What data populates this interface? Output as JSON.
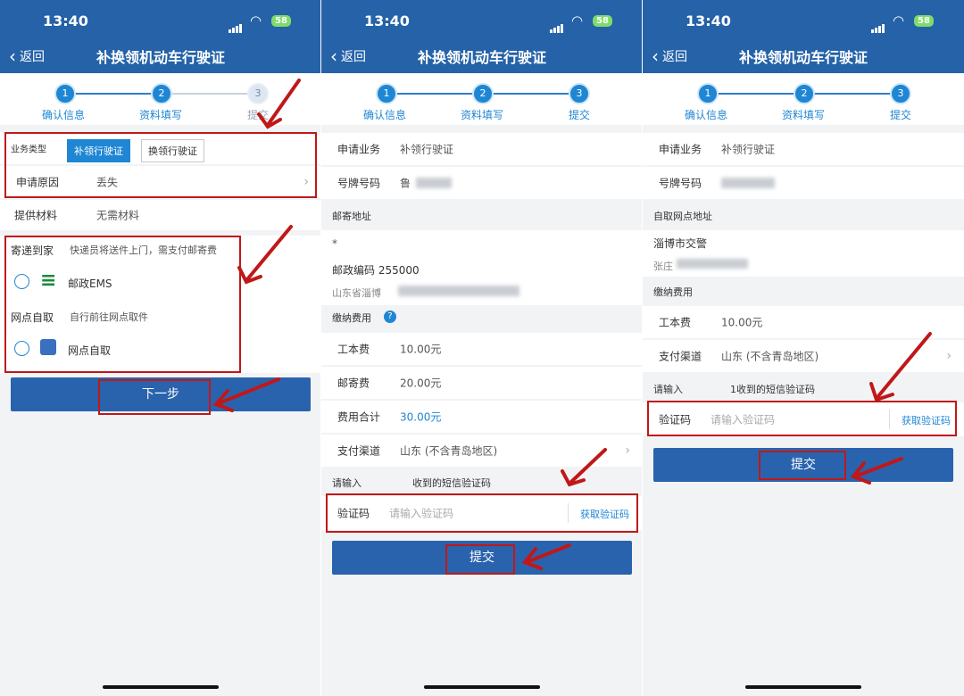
{
  "status_bar": {
    "time": "13:40",
    "battery": "58"
  },
  "nav": {
    "back_label": "返回",
    "title": "补换领机动车行驶证"
  },
  "steps": [
    "确认信息",
    "资料填写",
    "提交"
  ],
  "steps_partial_label": "提交",
  "panel1": {
    "business_type_label": "业务类型",
    "type_tabs": [
      "补领行驶证",
      "换领行驶证"
    ],
    "reason_label": "申请原因",
    "reason_value": "丢失",
    "materials_label": "提供材料",
    "materials_value": "无需材料",
    "delivery_label": "寄递到家",
    "delivery_desc": "快递员将送件上门，需支付邮寄费",
    "ems_label": "邮政EMS",
    "pickup_label": "网点自取",
    "pickup_desc": "自行前往网点取件",
    "pickup_option": "网点自取",
    "next_button": "下一步"
  },
  "panel2": {
    "apply_label": "申请业务",
    "apply_value": "补领行驶证",
    "plate_label": "号牌号码",
    "plate_value": "鲁",
    "mail_section": "邮寄地址",
    "asterisk": "*",
    "postcode": "邮政编码 255000",
    "province": "山东省淄博",
    "fee_section": "缴纳费用",
    "fee_items": [
      {
        "label": "工本费",
        "value": "10.00元"
      },
      {
        "label": "邮寄费",
        "value": "20.00元"
      },
      {
        "label": "费用合计",
        "value": "30.00元"
      }
    ],
    "pay_label": "支付渠道",
    "pay_value": "山东 (不含青岛地区)",
    "sms_prefix": "请输入",
    "sms_suffix": "收到的短信验证码",
    "code_label": "验证码",
    "code_placeholder": "请输入验证码",
    "get_code": "获取验证码",
    "submit": "提交"
  },
  "panel3": {
    "apply_label": "申请业务",
    "apply_value": "补领行驶证",
    "plate_label": "号牌号码",
    "pickup_section": "自取网点地址",
    "pickup_name": "淄博市交警",
    "pickup_addr": "张庄",
    "fee_section": "缴纳费用",
    "fee_label": "工本费",
    "fee_value": "10.00元",
    "pay_label": "支付渠道",
    "pay_value": "山东 (不含青岛地区)",
    "sms_prefix": "请输入",
    "sms_suffix": "1收到的短信验证码",
    "code_label": "验证码",
    "code_placeholder": "请输入验证码",
    "get_code": "获取验证码",
    "submit": "提交"
  },
  "colors": {
    "header": "#2562a8",
    "accent": "#1f86d4",
    "annotation": "#c01818"
  }
}
